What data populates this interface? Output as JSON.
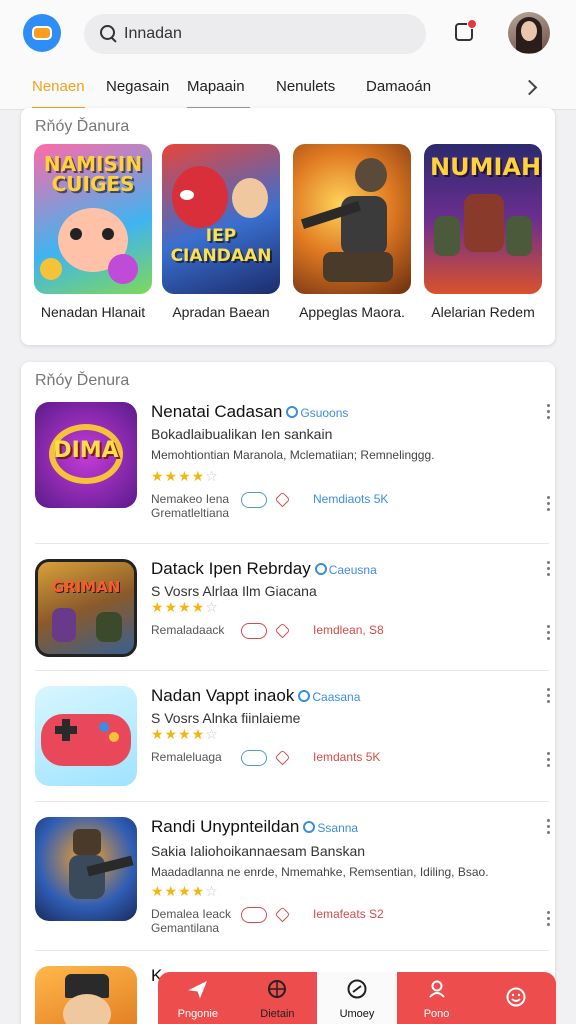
{
  "search": {
    "value": "Innadan"
  },
  "tabs": [
    {
      "label": "Nenaen",
      "state": "active"
    },
    {
      "label": "Negasain",
      "state": ""
    },
    {
      "label": "Mapaain",
      "state": "mid"
    },
    {
      "label": "Nenulets",
      "state": ""
    },
    {
      "label": "Damaoán",
      "state": ""
    }
  ],
  "featured": {
    "title": "Rňóy Ďanura",
    "items": [
      {
        "tile_text": "NAMISIN CUIGES",
        "name": "Nenadan Hlanait",
        "bg": "#3fb4f0",
        "accent": "#ff7a3c"
      },
      {
        "tile_text": "IEP CIANDAAN",
        "name": "Apradan Baean",
        "bg": "#3a6fcf",
        "accent": "#e53a35"
      },
      {
        "tile_text": "",
        "name": "Appeglas Maora.",
        "bg": "#e07a22",
        "accent": "#5a3b20"
      },
      {
        "tile_text": "NUMIAH",
        "name": "Alelarian Redem",
        "bg": "#6b2e8f",
        "accent": "#f5c23a"
      }
    ]
  },
  "list": {
    "title": "Rňóy Ďenura",
    "apps": [
      {
        "title": "Nenatai Cadasan",
        "verified": "Gsuoons",
        "subtitle": "Bokadlaibualikan Ien sankain",
        "description": "Memohtiontian Maranola, Mclematiian; Remnelinggg.",
        "rating": 4.5,
        "meta1": "Nemakeo Iena",
        "meta2": "Grematleltiana",
        "stat": "Nemdiaots   5K",
        "stat_color": "blue",
        "icon_text": "DIMA",
        "icon_bg": "#8a2bc7",
        "icon_accent": "#f5c23a"
      },
      {
        "title": "Datack Ipen Rebrday",
        "verified": "Caeusna",
        "subtitle": "S Vosrs  Alrlaa  Ilm  Giacana",
        "description": "",
        "rating": 4.5,
        "meta1": "Remaladaack",
        "meta2": "",
        "stat": "Iemdlean,   S8",
        "stat_color": "red",
        "icon_text": "GRIMAN",
        "icon_bg": "#d9a03a",
        "icon_accent": "#3a5f8f"
      },
      {
        "title": "Nadan Vappt inaok",
        "verified": "Caasana",
        "subtitle": "S Vosrs  Alnka  fiinlaieme",
        "description": "",
        "rating": 4.5,
        "meta1": "Remaleluaga",
        "meta2": "",
        "stat": "Iemdants   5K",
        "stat_color": "red",
        "icon_text": "",
        "icon_bg": "#9fe3ff",
        "icon_accent": "#e9485a"
      },
      {
        "title": "Randi Unypnteildan",
        "verified": "Ssanna",
        "subtitle": "Sakia  Ialiohoikannaesam  Banskan",
        "description": "Maadadlanna ne enrde, Nmemahke, Remsentian, Idiling, Bsao.",
        "rating": 4.5,
        "meta1": "Demalea Ieack",
        "meta2": "Gemantilana",
        "stat": "Iemafeats   S2",
        "stat_color": "red",
        "icon_text": "",
        "icon_bg": "#2f5db5",
        "icon_accent": "#f3a02a"
      }
    ]
  },
  "partial_row": {
    "title_start": "K"
  },
  "bottom_nav": [
    {
      "label": "Pngonie",
      "icon": "plane-icon"
    },
    {
      "label": "Dietain",
      "icon": "ball-icon"
    },
    {
      "label": "Umoey",
      "icon": "compass-icon"
    },
    {
      "label": "Pono",
      "icon": "user-icon"
    },
    {
      "label": "",
      "icon": "smile-icon"
    }
  ]
}
